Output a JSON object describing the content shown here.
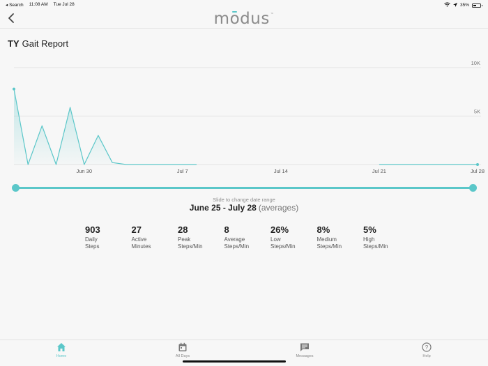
{
  "status_bar": {
    "back_app": "◂ Search",
    "time": "11:08 AM",
    "date": "Tue Jul 28",
    "battery": "35%",
    "battery_level": 0.35
  },
  "header": {
    "logo": "modus",
    "logo_tm": "™"
  },
  "page": {
    "initials": "TY",
    "title": "Gait Report"
  },
  "chart_data": {
    "type": "area",
    "x_tick_labels": [
      "Jun 30",
      "Jul 7",
      "Jul 14",
      "Jul 21",
      "Jul 28"
    ],
    "y_tick_labels": [
      "10K",
      "5K"
    ],
    "ylim": [
      0,
      10000
    ],
    "grid": true,
    "segments": [
      {
        "x": [
          "Jun 25",
          "Jun 26",
          "Jun 27",
          "Jun 28",
          "Jun 29",
          "Jun 30",
          "Jul 1",
          "Jul 2",
          "Jul 3",
          "Jul 4",
          "Jul 5",
          "Jul 6",
          "Jul 7",
          "Jul 8"
        ],
        "values": [
          7800,
          0,
          4000,
          0,
          5900,
          0,
          3000,
          200,
          0,
          0,
          0,
          0,
          0,
          0
        ]
      },
      {
        "x": [
          "Jul 21",
          "Jul 22",
          "Jul 23",
          "Jul 24",
          "Jul 25",
          "Jul 26",
          "Jul 27",
          "Jul 28"
        ],
        "values": [
          0,
          0,
          0,
          0,
          0,
          0,
          0,
          0
        ]
      }
    ],
    "first_point_marker": true,
    "last_point_marker": true,
    "color": "#5bc7c9"
  },
  "range": {
    "hint": "Slide to change date range",
    "range_text": "June 25 - July 28",
    "suffix": "(averages)",
    "start_fraction": 0.0,
    "end_fraction": 1.0
  },
  "stats": [
    {
      "value": "903",
      "line1": "Daily",
      "line2": "Steps"
    },
    {
      "value": "27",
      "line1": "Active",
      "line2": "Minutes"
    },
    {
      "value": "28",
      "line1": "Peak",
      "line2": "Steps/Min"
    },
    {
      "value": "8",
      "line1": "Average",
      "line2": "Steps/Min"
    },
    {
      "value": "26%",
      "line1": "Low",
      "line2": "Steps/Min"
    },
    {
      "value": "8%",
      "line1": "Medium",
      "line2": "Steps/Min"
    },
    {
      "value": "5%",
      "line1": "High",
      "line2": "Steps/Min"
    }
  ],
  "tabs": [
    {
      "label": "Home",
      "icon": "home-icon",
      "active": true
    },
    {
      "label": "All Days",
      "icon": "calendar-icon",
      "active": false
    },
    {
      "label": "Messages",
      "icon": "message-icon",
      "active": false
    },
    {
      "label": "Help",
      "icon": "help-icon",
      "active": false
    }
  ],
  "colors": {
    "accent": "#5bc7c9",
    "background": "#f7f7f7",
    "text": "#222222",
    "muted": "#888888"
  }
}
